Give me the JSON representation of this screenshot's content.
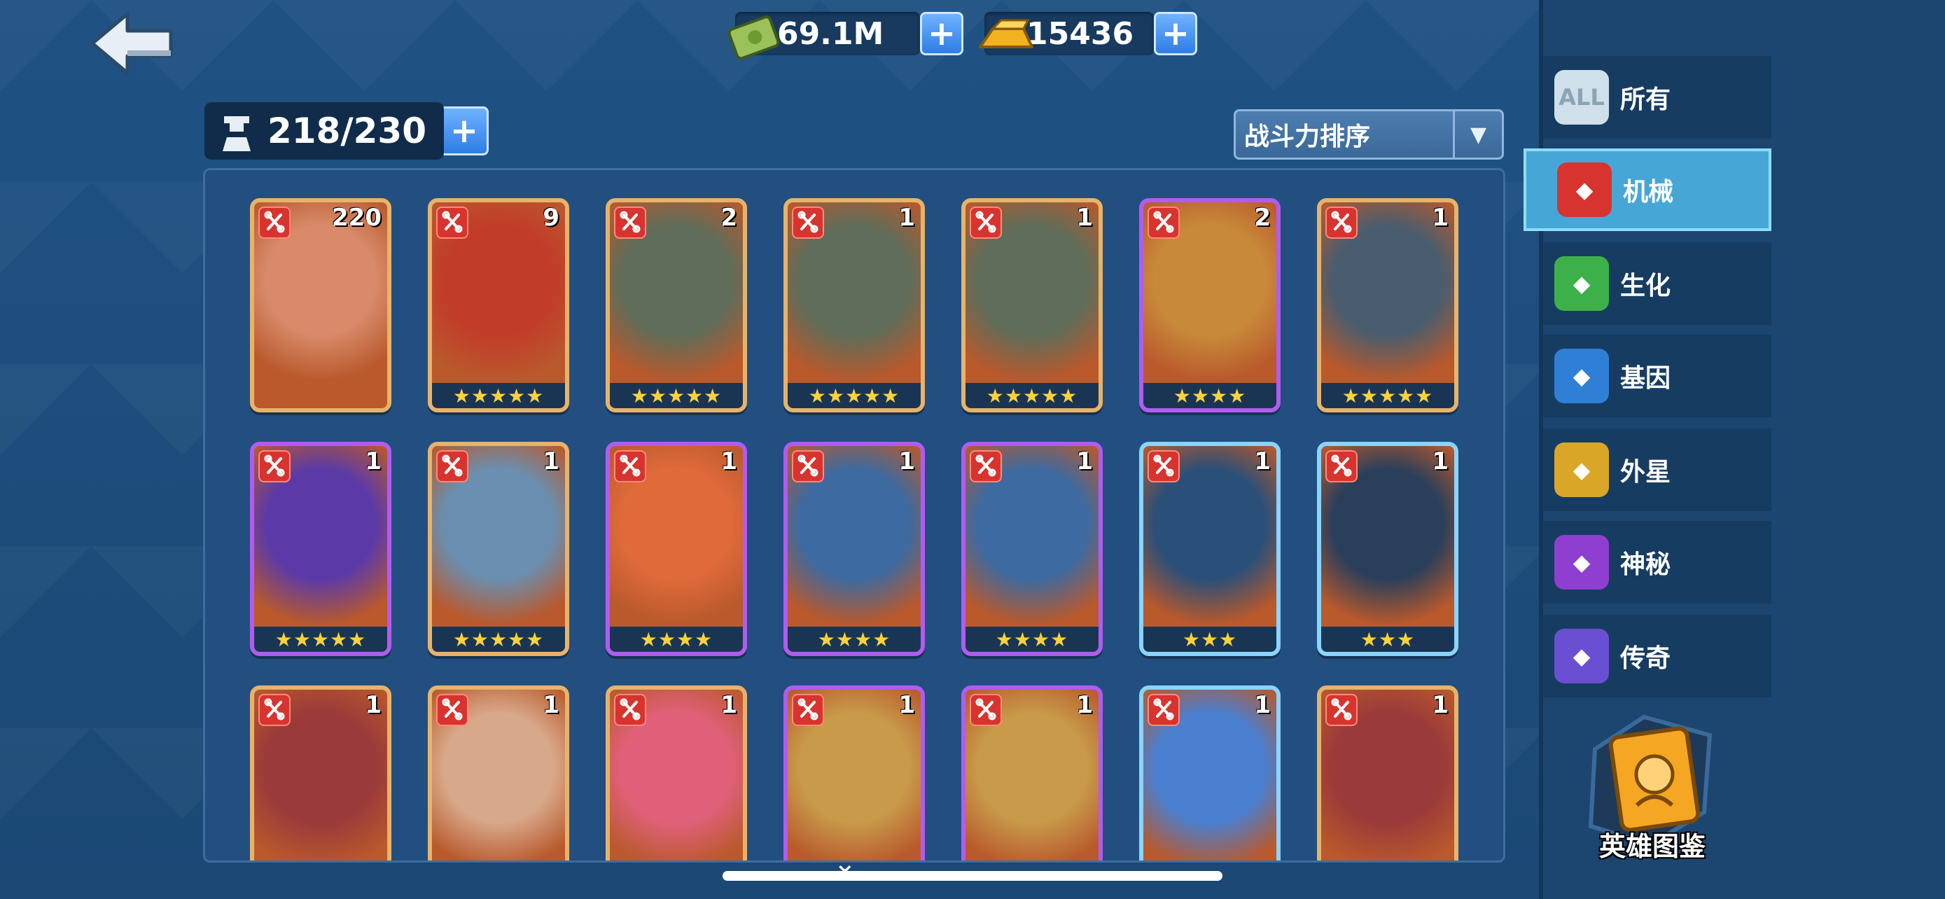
{
  "currency": {
    "cash": "69.1M",
    "gold": "15436"
  },
  "hero_count": "218/230",
  "sort": {
    "selected": "战斗力排序"
  },
  "categories": [
    {
      "label": "所有",
      "icon": "all-icon",
      "icon_text": "ALL",
      "color": "#cfe0ea"
    },
    {
      "label": "机械",
      "icon": "mechanical-icon",
      "color": "#d8342f"
    },
    {
      "label": "生化",
      "icon": "biochem-icon",
      "color": "#3db04a"
    },
    {
      "label": "基因",
      "icon": "gene-icon",
      "color": "#2f7fd6"
    },
    {
      "label": "外星",
      "icon": "alien-icon",
      "color": "#d9a628"
    },
    {
      "label": "神秘",
      "icon": "mystery-icon",
      "color": "#8e3fd0"
    },
    {
      "label": "传奇",
      "icon": "legend-icon",
      "color": "#6a4fd3"
    }
  ],
  "active_category": "机械",
  "dex_label": "英雄图鉴",
  "cards": [
    {
      "level": "220",
      "stars": "",
      "frame": "gold",
      "color": "#d88a6a"
    },
    {
      "level": "9",
      "stars": "★★★★★",
      "frame": "gold",
      "color": "#c23c2a"
    },
    {
      "level": "2",
      "stars": "★★★★★",
      "frame": "gold",
      "color": "#5f6d5a"
    },
    {
      "level": "1",
      "stars": "★★★★★",
      "frame": "gold",
      "color": "#5f6d5a"
    },
    {
      "level": "1",
      "stars": "★★★★★",
      "frame": "gold",
      "color": "#5f6d5a"
    },
    {
      "level": "2",
      "stars": "★★★★",
      "frame": "purple",
      "color": "#c88a3a"
    },
    {
      "level": "1",
      "stars": "★★★★★",
      "frame": "gold",
      "color": "#4a5d6e"
    },
    {
      "level": "1",
      "stars": "★★★★★",
      "frame": "purple",
      "color": "#5b3aa8"
    },
    {
      "level": "1",
      "stars": "★★★★★",
      "frame": "gold",
      "color": "#6a8fb0"
    },
    {
      "level": "1",
      "stars": "★★★★",
      "frame": "purple",
      "color": "#e06a3a"
    },
    {
      "level": "1",
      "stars": "★★★★",
      "frame": "purple",
      "color": "#3d6aa0"
    },
    {
      "level": "1",
      "stars": "★★★★",
      "frame": "purple",
      "color": "#3d6aa0"
    },
    {
      "level": "1",
      "stars": "★★★",
      "frame": "blue",
      "color": "#2a4f78"
    },
    {
      "level": "1",
      "stars": "★★★",
      "frame": "blue",
      "color": "#2a3f5a"
    },
    {
      "level": "1",
      "stars": "",
      "frame": "gold",
      "color": "#9a3a3a"
    },
    {
      "level": "1",
      "stars": "",
      "frame": "gold",
      "color": "#d8a88a"
    },
    {
      "level": "1",
      "stars": "",
      "frame": "gold",
      "color": "#e0607a"
    },
    {
      "level": "1",
      "stars": "",
      "frame": "purple",
      "color": "#c89a4a"
    },
    {
      "level": "1",
      "stars": "",
      "frame": "purple",
      "color": "#c89a4a"
    },
    {
      "level": "1",
      "stars": "",
      "frame": "blue",
      "color": "#4a7fd0"
    },
    {
      "level": "1",
      "stars": "",
      "frame": "gold",
      "color": "#9a3a3a"
    }
  ]
}
